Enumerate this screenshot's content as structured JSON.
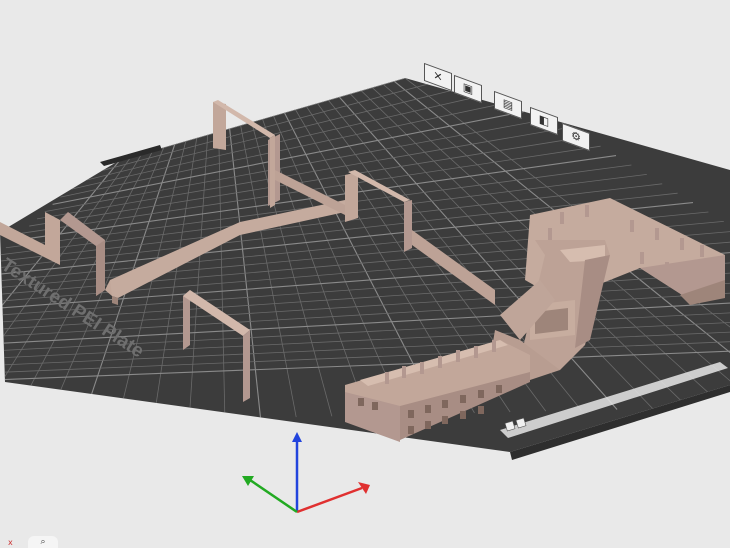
{
  "plate": {
    "label": "Textured PEI Plate",
    "strip_text": "...",
    "colors": {
      "plate": "#3c3c3c",
      "grid": "#6a6a6a",
      "grid_major": "#8a8a8a",
      "model": "#c2a79a",
      "model_shadow": "#9e857a",
      "background": "#e9e9e9"
    }
  },
  "toolbar": {
    "icons": [
      "close-icon",
      "save-icon",
      "list-icon",
      "layers-icon",
      "settings-icon"
    ],
    "glyphs": [
      "✕",
      "▣",
      "▤",
      "◧",
      "⚙"
    ]
  },
  "axes": {
    "colors": {
      "x": "#e03030",
      "y": "#22aa22",
      "z": "#2244dd"
    }
  },
  "corner": {
    "glyph": "⌕",
    "mark": "x"
  }
}
